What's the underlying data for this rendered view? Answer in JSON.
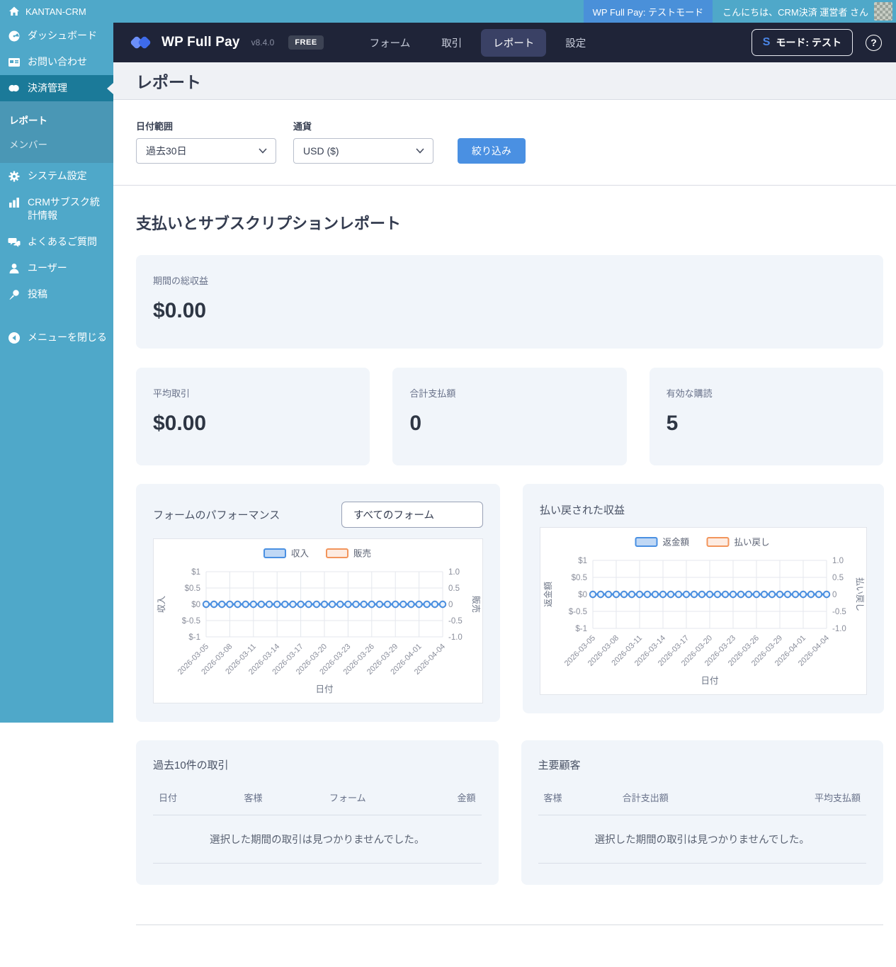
{
  "theme": {
    "sidebar_teal": "#4FA8C9",
    "sidebar_active_teal": "#1B7A99",
    "submenu_teal": "#4A97B5",
    "admin_badge_blue": "#4A90D9",
    "nav_dark": "#1F2438",
    "nav_active": "#3A4165",
    "accent_blue": "#4A90E2",
    "chart_orange": "#F2955C",
    "card_bg": "#F1F5FA"
  },
  "admin_bar": {
    "site_name": "KANTAN-CRM",
    "test_mode_badge": "WP Full Pay: テストモード",
    "greeting": "こんにちは、CRM決済 運営者 さん"
  },
  "sidebar": {
    "items": [
      {
        "label": "ダッシュボード",
        "icon": "dashboard-icon"
      },
      {
        "label": "お問い合わせ",
        "icon": "feedback-icon"
      },
      {
        "label": "決済管理",
        "icon": "payments-icon",
        "active": true
      },
      {
        "label": "システム設定",
        "icon": "gear-icon"
      },
      {
        "label": "CRMサブスク統計情報",
        "icon": "chart-bar-icon"
      },
      {
        "label": "よくあるご質問",
        "icon": "comments-icon"
      },
      {
        "label": "ユーザー",
        "icon": "user-icon"
      },
      {
        "label": "投稿",
        "icon": "pin-icon"
      }
    ],
    "submenu": {
      "items": [
        {
          "label": "レポート",
          "current": true
        },
        {
          "label": "メンバー",
          "current": false
        }
      ]
    },
    "collapse_label": "メニューを閉じる"
  },
  "nav": {
    "brand": "WP Full Pay",
    "version": "v8.4.0",
    "badge": "FREE",
    "items": [
      {
        "label": "フォーム"
      },
      {
        "label": "取引"
      },
      {
        "label": "レポート",
        "active": true
      },
      {
        "label": "設定"
      }
    ],
    "mode_button": {
      "s": "S",
      "label": "モード: テスト"
    },
    "help": "?"
  },
  "page": {
    "title": "レポート"
  },
  "filters": {
    "date_label": "日付範囲",
    "date_value": "過去30日",
    "currency_label": "通貨",
    "currency_value": "USD ($)",
    "submit_label": "絞り込み"
  },
  "report": {
    "heading": "支払いとサブスクリプションレポート",
    "cards": [
      {
        "label": "期間の総収益",
        "value": "$0.00"
      },
      {
        "label": "平均取引",
        "value": "$0.00"
      },
      {
        "label": "合計支払額",
        "value": "0"
      },
      {
        "label": "有効な購読",
        "value": "5"
      }
    ]
  },
  "chart_data": [
    {
      "type": "line",
      "title": "フォームのパフォーマンス",
      "form_filter_value": "すべてのフォーム",
      "x": [
        "2026-03-05",
        "2026-03-06",
        "2026-03-07",
        "2026-03-08",
        "2026-03-09",
        "2026-03-10",
        "2026-03-11",
        "2026-03-12",
        "2026-03-13",
        "2026-03-14",
        "2026-03-15",
        "2026-03-16",
        "2026-03-17",
        "2026-03-18",
        "2026-03-19",
        "2026-03-20",
        "2026-03-21",
        "2026-03-22",
        "2026-03-23",
        "2026-03-24",
        "2026-03-25",
        "2026-03-26",
        "2026-03-27",
        "2026-03-28",
        "2026-03-29",
        "2026-03-30",
        "2026-03-31",
        "2026-04-01",
        "2026-04-02",
        "2026-04-03",
        "2026-04-04"
      ],
      "x_tick_labels": [
        "2026-03-05",
        "2026-03-08",
        "2026-03-11",
        "2026-03-14",
        "2026-03-17",
        "2026-03-20",
        "2026-03-23",
        "2026-03-26",
        "2026-03-29",
        "2026-04-01",
        "2026-04-04"
      ],
      "series": [
        {
          "name": "販売",
          "color": "#F2955C",
          "legend_fill": "rgba(242,149,92,0.18)",
          "axis": "right",
          "values": [
            0,
            0,
            0,
            0,
            0,
            0,
            0,
            0,
            0,
            0,
            0,
            0,
            0,
            0,
            0,
            0,
            0,
            0,
            0,
            0,
            0,
            0,
            0,
            0,
            0,
            0,
            0,
            0,
            0,
            0,
            0
          ]
        },
        {
          "name": "収入",
          "color": "#4A90E2",
          "legend_fill": "rgba(74,144,226,0.35)",
          "axis": "left",
          "values": [
            0,
            0,
            0,
            0,
            0,
            0,
            0,
            0,
            0,
            0,
            0,
            0,
            0,
            0,
            0,
            0,
            0,
            0,
            0,
            0,
            0,
            0,
            0,
            0,
            0,
            0,
            0,
            0,
            0,
            0,
            0
          ]
        }
      ],
      "legend_order": [
        "収入",
        "販売"
      ],
      "xlabel": "日付",
      "ylabel_left": "収入",
      "ylabel_right": "販売",
      "yticks_left": [
        "$1",
        "$0.5",
        "$0",
        "$-0.5",
        "$-1"
      ],
      "yticks_right": [
        "1.0",
        "0.5",
        "0",
        "-0.5",
        "-1.0"
      ],
      "ylim": [
        -1,
        1
      ],
      "grid": true,
      "legend_position": "top"
    },
    {
      "type": "line",
      "title": "払い戻された収益",
      "x": [
        "2026-03-05",
        "2026-03-06",
        "2026-03-07",
        "2026-03-08",
        "2026-03-09",
        "2026-03-10",
        "2026-03-11",
        "2026-03-12",
        "2026-03-13",
        "2026-03-14",
        "2026-03-15",
        "2026-03-16",
        "2026-03-17",
        "2026-03-18",
        "2026-03-19",
        "2026-03-20",
        "2026-03-21",
        "2026-03-22",
        "2026-03-23",
        "2026-03-24",
        "2026-03-25",
        "2026-03-26",
        "2026-03-27",
        "2026-03-28",
        "2026-03-29",
        "2026-03-30",
        "2026-03-31",
        "2026-04-01",
        "2026-04-02",
        "2026-04-03",
        "2026-04-04"
      ],
      "x_tick_labels": [
        "2026-03-05",
        "2026-03-08",
        "2026-03-11",
        "2026-03-14",
        "2026-03-17",
        "2026-03-20",
        "2026-03-23",
        "2026-03-26",
        "2026-03-29",
        "2026-04-01",
        "2026-04-04"
      ],
      "series": [
        {
          "name": "払い戻し",
          "color": "#F2955C",
          "legend_fill": "rgba(242,149,92,0.18)",
          "axis": "right",
          "values": [
            0,
            0,
            0,
            0,
            0,
            0,
            0,
            0,
            0,
            0,
            0,
            0,
            0,
            0,
            0,
            0,
            0,
            0,
            0,
            0,
            0,
            0,
            0,
            0,
            0,
            0,
            0,
            0,
            0,
            0,
            0
          ]
        },
        {
          "name": "返金額",
          "color": "#4A90E2",
          "legend_fill": "rgba(74,144,226,0.35)",
          "axis": "left",
          "values": [
            0,
            0,
            0,
            0,
            0,
            0,
            0,
            0,
            0,
            0,
            0,
            0,
            0,
            0,
            0,
            0,
            0,
            0,
            0,
            0,
            0,
            0,
            0,
            0,
            0,
            0,
            0,
            0,
            0,
            0,
            0
          ]
        }
      ],
      "legend_order": [
        "返金額",
        "払い戻し"
      ],
      "xlabel": "日付",
      "ylabel_left": "返金額",
      "ylabel_right": "払い戻し",
      "yticks_left": [
        "$1",
        "$0.5",
        "$0",
        "$-0.5",
        "$-1"
      ],
      "yticks_right": [
        "1.0",
        "0.5",
        "0",
        "-0.5",
        "-1.0"
      ],
      "ylim": [
        -1,
        1
      ],
      "grid": true,
      "legend_position": "top"
    }
  ],
  "tables": [
    {
      "title": "過去10件の取引",
      "headers": [
        "日付",
        "客様",
        "フォーム",
        "金額"
      ],
      "empty_message": "選択した期間の取引は見つかりませんでした。"
    },
    {
      "title": "主要顧客",
      "headers": [
        "客様",
        "合計支出額",
        "平均支払額"
      ],
      "empty_message": "選択した期間の取引は見つかりませんでした。"
    }
  ]
}
